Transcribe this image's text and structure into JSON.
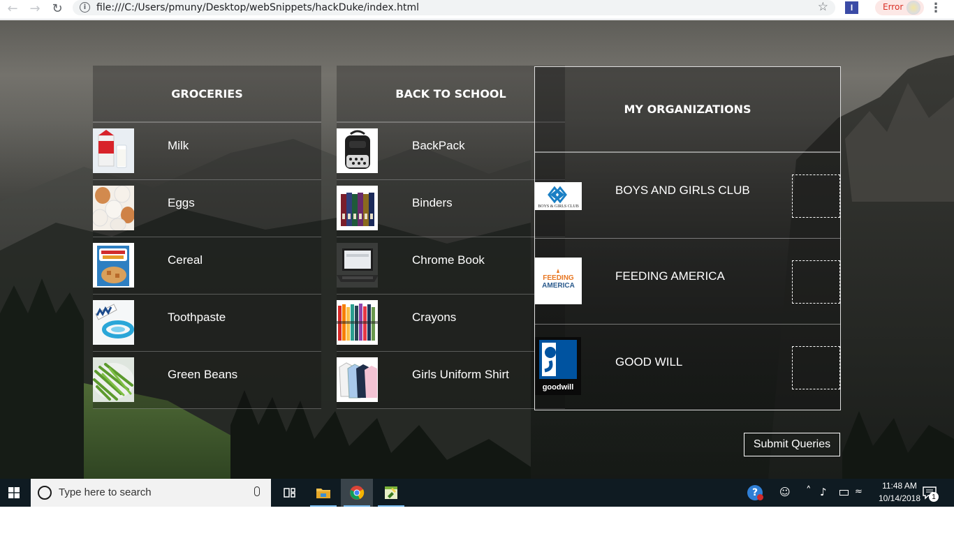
{
  "browser": {
    "url": "file:///C:/Users/pmuny/Desktop/webSnippets/hackDuke/index.html",
    "error_label": "Error",
    "extension_label": "I"
  },
  "groceries": {
    "title": "GROCERIES",
    "items": [
      {
        "label": "Milk",
        "icon": "milk-carton-icon"
      },
      {
        "label": "Eggs",
        "icon": "eggs-icon"
      },
      {
        "label": "Cereal",
        "icon": "cereal-box-icon"
      },
      {
        "label": "Toothpaste",
        "icon": "toothpaste-icon"
      },
      {
        "label": "Green Beans",
        "icon": "green-beans-icon"
      }
    ]
  },
  "school": {
    "title": "BACK TO SCHOOL",
    "items": [
      {
        "label": "BackPack",
        "icon": "backpack-icon"
      },
      {
        "label": "Binders",
        "icon": "binders-icon"
      },
      {
        "label": "Chrome Book",
        "icon": "laptop-icon"
      },
      {
        "label": "Crayons",
        "icon": "crayons-icon"
      },
      {
        "label": "Girls Uniform Shirt",
        "icon": "shirts-icon"
      }
    ]
  },
  "organizations": {
    "title": "MY ORGANIZATIONS",
    "items": [
      {
        "label": "BOYS AND GIRLS CLUB",
        "logo_text": "BOYS & GIRLS CLUB",
        "logo_color": "#1a7fc4"
      },
      {
        "label": "FEEDING AMERICA",
        "logo_text_1": "FEEDING",
        "logo_text_2": "AMERICA",
        "logo_color": "#e87722"
      },
      {
        "label": "GOOD WILL",
        "logo_text": "goodwill",
        "logo_color": "#0053a0"
      }
    ]
  },
  "submit_label": "Submit Queries",
  "taskbar": {
    "search_placeholder": "Type here to search",
    "time": "11:48 AM",
    "date": "10/14/2018",
    "notification_count": "1"
  }
}
